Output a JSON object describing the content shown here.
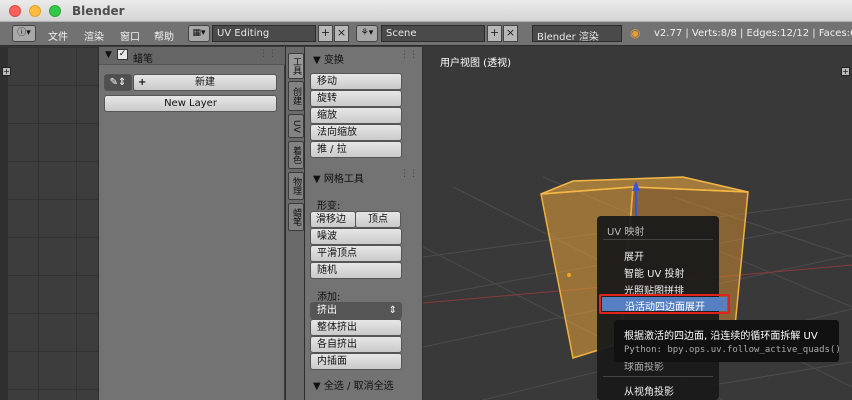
{
  "window": {
    "title": "Blender"
  },
  "header": {
    "menus": [
      "文件",
      "渲染",
      "窗口",
      "帮助"
    ],
    "screen_layout": "UV Editing",
    "scene": "Scene",
    "render_engine": "Blender 渲染",
    "stats": "v2.77 | Verts:8/8 | Edges:12/12 | Faces:6/6 | T"
  },
  "grease_pencil": {
    "section_title": "蜡笔",
    "new_label": "新建",
    "new_layer_label": "New Layer"
  },
  "tabs": [
    "工具",
    "创建",
    "UV",
    "着色",
    "物理",
    "蜡笔"
  ],
  "tools": {
    "transform_title": "变换",
    "transform_buttons": [
      "移动",
      "旋转",
      "缩放",
      "法向缩放",
      "推 / 拉"
    ],
    "mesh_tools_title": "网格工具",
    "deform_label": "形变:",
    "slide_edge": "滑移边",
    "vertex": "顶点",
    "noise": "噪波",
    "smooth_vertex": "平滑顶点",
    "random": "随机",
    "add_label": "添加:",
    "extrude": "挤出",
    "extrude_region": "整体挤出",
    "extrude_individual": "各自挤出",
    "inset": "内插面",
    "select_title": "全选 / 取消全选"
  },
  "viewport": {
    "label": "用户视图 (透视)"
  },
  "uv_menu": {
    "title": "UV 映射",
    "items": [
      "展开",
      "智能 UV 投射",
      "光照贴图拼排",
      "沿活动四边面展开",
      "球面投影",
      "从视角投影"
    ],
    "highlighted": "沿活动四边面展开"
  },
  "tooltip": {
    "description": "根据激活的四边面, 沿连续的循环面拆解 UV",
    "python": "Python: bpy.ops.uv.follow_active_quads()"
  },
  "colors": {
    "accent": "#5680c2",
    "highlight_border": "#e0231f",
    "selection": "#e8a33a"
  }
}
